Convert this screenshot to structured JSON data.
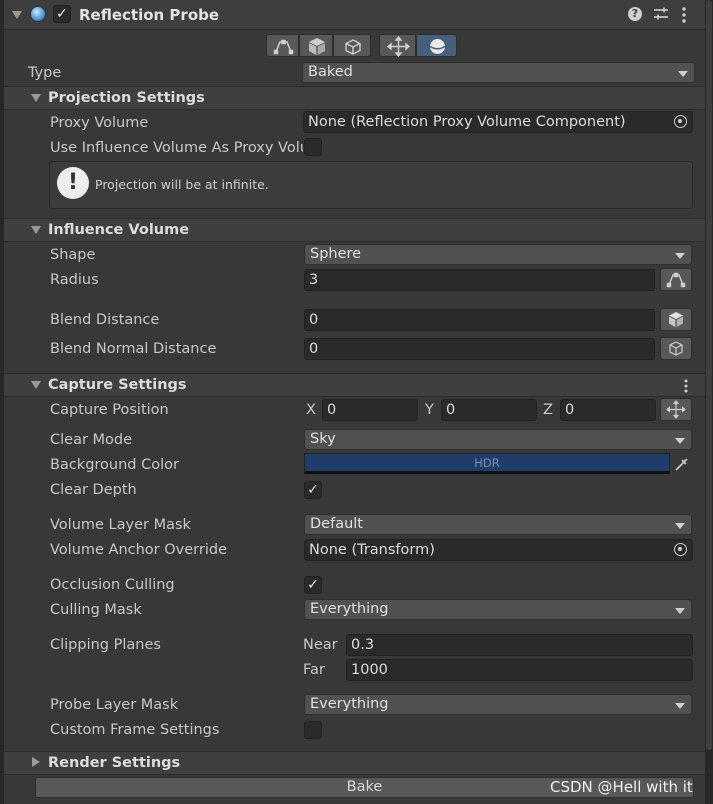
{
  "component": {
    "title": "Reflection Probe",
    "enabled": true,
    "icons": [
      "collapse-triangle-icon",
      "reflection-probe-icon",
      "help-icon",
      "preset-icon",
      "kebab-menu-icon"
    ]
  },
  "toolbar": {
    "buttons": [
      "edit-influence-icon",
      "box-icon",
      "box-small-icon",
      "move-icon",
      "sphere-icon"
    ],
    "active": "sphere-icon"
  },
  "type": {
    "label": "Type",
    "value": "Baked"
  },
  "projection_settings": {
    "title": "Projection Settings",
    "proxy_volume": {
      "label": "Proxy Volume",
      "value": "None (Reflection Proxy Volume Component)"
    },
    "use_influence": {
      "label": "Use Influence Volume As Proxy Volu",
      "checked": false
    },
    "help": {
      "text": "Projection will be at infinite."
    }
  },
  "influence_volume": {
    "title": "Influence Volume",
    "shape": {
      "label": "Shape",
      "value": "Sphere"
    },
    "radius": {
      "label": "Radius",
      "value": "3"
    },
    "blend_distance": {
      "label": "Blend Distance",
      "value": "0"
    },
    "blend_normal_distance": {
      "label": "Blend Normal Distance",
      "value": "0"
    }
  },
  "capture_settings": {
    "title": "Capture Settings",
    "capture_position": {
      "label": "Capture Position",
      "x_label": "X",
      "x": "0",
      "y_label": "Y",
      "y": "0",
      "z_label": "Z",
      "z": "0"
    },
    "clear_mode": {
      "label": "Clear Mode",
      "value": "Sky"
    },
    "background_color": {
      "label": "Background Color",
      "hdr": "HDR",
      "color": "#1f3c6b"
    },
    "clear_depth": {
      "label": "Clear Depth",
      "checked": true
    },
    "volume_layer_mask": {
      "label": "Volume Layer Mask",
      "value": "Default"
    },
    "volume_anchor_override": {
      "label": "Volume Anchor Override",
      "value": "None (Transform)"
    },
    "occlusion_culling": {
      "label": "Occlusion Culling",
      "checked": true
    },
    "culling_mask": {
      "label": "Culling Mask",
      "value": "Everything"
    },
    "clipping_planes": {
      "label": "Clipping Planes",
      "near_label": "Near",
      "near": "0.3",
      "far_label": "Far",
      "far": "1000"
    },
    "probe_layer_mask": {
      "label": "Probe Layer Mask",
      "value": "Everything"
    },
    "custom_frame_settings": {
      "label": "Custom Frame Settings",
      "checked": false
    }
  },
  "render_settings": {
    "title": "Render Settings"
  },
  "bake_button": {
    "label": "Bake"
  },
  "watermark": "CSDN @Hell with it",
  "colors": {
    "panel": "#383838",
    "header": "#3e3e3e",
    "field": "#2a2a2a",
    "button": "#585858",
    "active_button": "#46607c"
  }
}
